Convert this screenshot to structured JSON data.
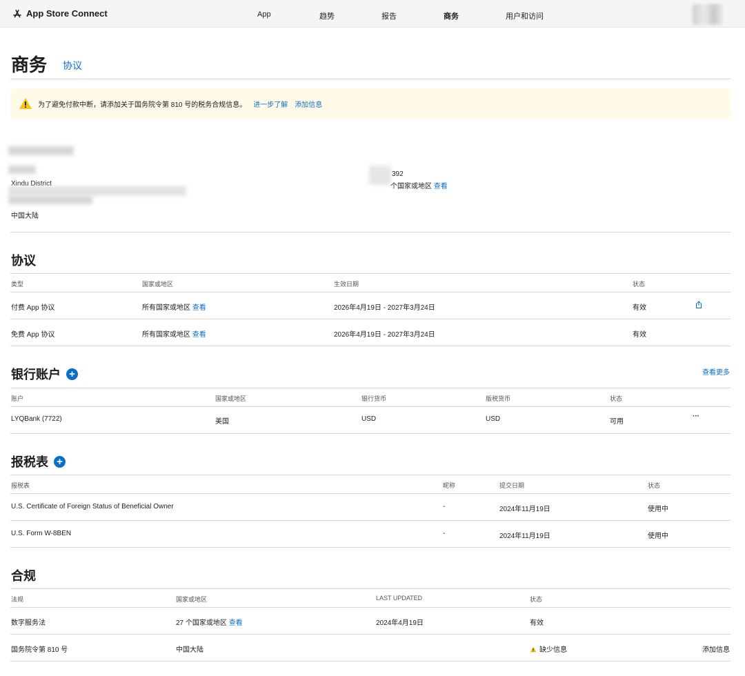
{
  "nav": {
    "brand": "App Store Connect",
    "items": [
      "App",
      "趋势",
      "报告",
      "商务",
      "用户和访问"
    ],
    "active_index": 3
  },
  "header": {
    "title": "商务",
    "link": "协议"
  },
  "banner": {
    "text": "为了避免付款中断，请添加关于国务院令第 810 号的税务合规信息。",
    "learn_more": "进一步了解",
    "add_info": "添加信息"
  },
  "account": {
    "district": "Xindu District",
    "country": "中国大陆",
    "id_suffix": "392",
    "countries_text": "个国家或地区",
    "view": "查看"
  },
  "agreements": {
    "title": "协议",
    "columns": [
      "类型",
      "国家或地区",
      "生效日期",
      "状态"
    ],
    "rows": [
      {
        "type": "付费 App 协议",
        "region": "所有国家或地区",
        "view": "查看",
        "date": "2026年4月19日 - 2027年3月24日",
        "status": "有效"
      },
      {
        "type": "免费 App 协议",
        "region": "所有国家或地区",
        "view": "查看",
        "date": "2026年4月19日 - 2027年3月24日",
        "status": "有效"
      }
    ]
  },
  "bank": {
    "title": "银行账户",
    "see_more": "查看更多",
    "columns": [
      "账户",
      "国家或地区",
      "银行货币",
      "版税货币",
      "状态"
    ],
    "rows": [
      {
        "account": "LYQBank (7722)",
        "region": "美国",
        "bank_currency": "USD",
        "royalty_currency": "USD",
        "status": "可用",
        "more": "···"
      }
    ]
  },
  "tax": {
    "title": "报税表",
    "columns": [
      "报税表",
      "昵称",
      "提交日期",
      "状态"
    ],
    "rows": [
      {
        "form": "U.S. Certificate of Foreign Status of Beneficial Owner",
        "nickname": "-",
        "date": "2024年11月19日",
        "status": "使用中"
      },
      {
        "form": "U.S. Form W-8BEN",
        "nickname": "-",
        "date": "2024年11月19日",
        "status": "使用中"
      }
    ]
  },
  "compliance": {
    "title": "合规",
    "columns": [
      "法规",
      "国家或地区",
      "LAST UPDATED",
      "状态"
    ],
    "rows": [
      {
        "law": "数字服务法",
        "region": "27 个国家或地区",
        "view": "查看",
        "updated": "2024年4月19日",
        "status": "有效",
        "action": ""
      },
      {
        "law": "国务院令第 810 号",
        "region": "中国大陆",
        "view": "",
        "updated": "",
        "status": "缺少信息",
        "action": "添加信息"
      }
    ]
  },
  "colors": {
    "link": "#0a6ecd",
    "banner_bg": "#fffbe8",
    "warning": "#f5c518"
  }
}
